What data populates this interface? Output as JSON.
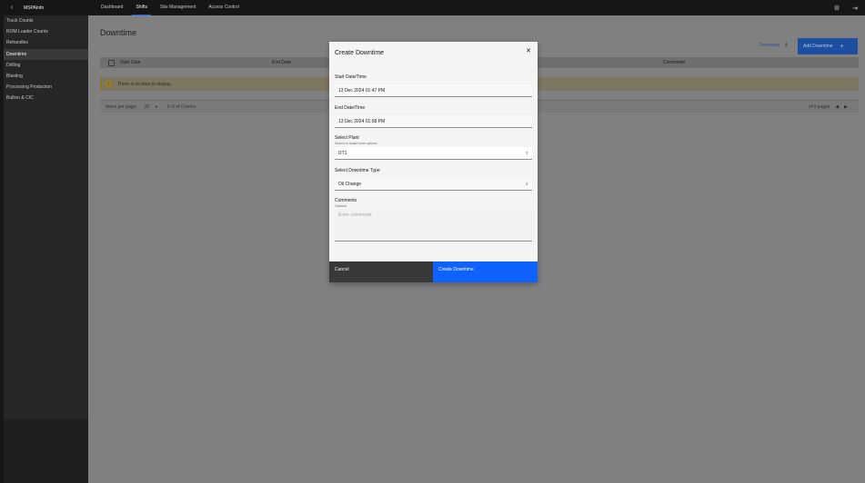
{
  "app": {
    "name": "MSPAInfo",
    "back_icon": "chevron-left-icon"
  },
  "topnav": {
    "items": [
      {
        "label": "Dashboard"
      },
      {
        "label": "Shifts"
      },
      {
        "label": "Site Management"
      },
      {
        "label": "Access Control"
      }
    ],
    "active": "Shifts"
  },
  "top_icons": [
    "settings-icon",
    "logout-icon"
  ],
  "sidebar": {
    "items": [
      {
        "label": "Truck Counts"
      },
      {
        "label": "ROM Loader Counts"
      },
      {
        "label": "Rehandles"
      },
      {
        "label": "Downtime"
      },
      {
        "label": "Drilling"
      },
      {
        "label": "Blasting"
      },
      {
        "label": "Processing Production"
      },
      {
        "label": "Bullion & CIC"
      }
    ],
    "active": "Downtime"
  },
  "page": {
    "title": "Downtime",
    "download_label": "Download",
    "add_label": "Add Downtime"
  },
  "table": {
    "headers": {
      "start": "Start Date",
      "end": "End Date",
      "comments": "Comments"
    },
    "empty_message": "There is no data to display.",
    "pagination": {
      "items_per_page_label": "Items per page:",
      "items_per_page_value": "20",
      "range": "0–0 of 0 items",
      "pages": "of 0 pages"
    }
  },
  "modal": {
    "title": "Create Downtime",
    "start": {
      "label": "Start Date/Time",
      "value": "13 Dec 2024 01:47 PM"
    },
    "end": {
      "label": "End Date/Time",
      "value": "13 Dec 2024 01:58 PM"
    },
    "plant": {
      "label": "Select Plant",
      "helper": "Search to locate more options",
      "value": "DT1"
    },
    "downtime_type": {
      "label": "Select Downtime Type",
      "value": "Oil Change"
    },
    "comments": {
      "label": "Comments",
      "helper": "Optional",
      "placeholder": "Enter comments"
    },
    "cancel_label": "Cancel",
    "create_label": "Create Downtime"
  },
  "colors": {
    "primary": "#0f62fe",
    "header_bg": "#161616",
    "sidebar_bg": "#262626"
  }
}
